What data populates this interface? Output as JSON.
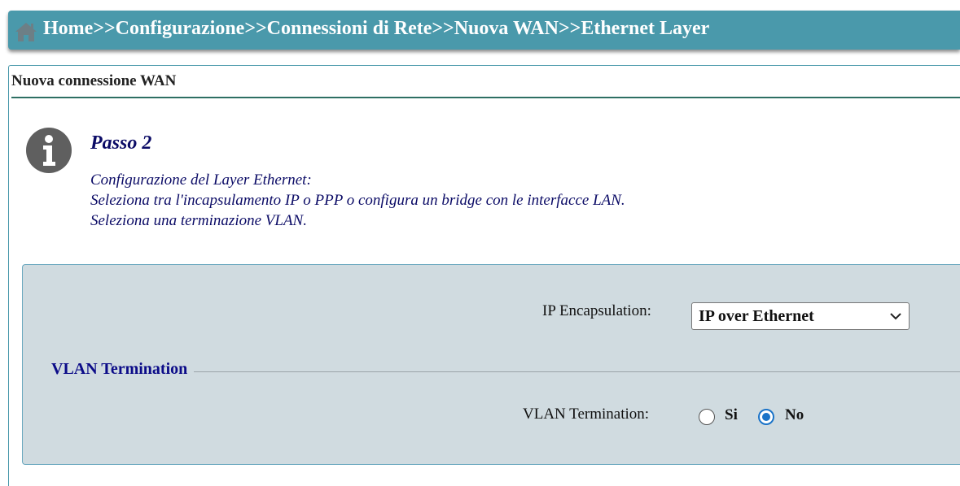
{
  "breadcrumb": {
    "text": "Home>>Configurazione>>Connessioni di Rete>>Nuova WAN>>Ethernet Layer",
    "icon": "home-icon"
  },
  "panel": {
    "title": "Nuova connessione WAN"
  },
  "step": {
    "icon": "info-icon",
    "title": "Passo 2",
    "lines": [
      "Configurazione del Layer Ethernet:",
      "Seleziona tra l'incapsulamento IP o PPP o configura un bridge con le interfacce LAN.",
      "Seleziona una terminazione VLAN."
    ]
  },
  "form": {
    "ip_encapsulation_label": "IP Encapsulation:",
    "ip_encapsulation_value": "IP over Ethernet",
    "vlan_section_title": "VLAN Termination",
    "vlan_termination_label": "VLAN Termination:",
    "vlan_options": [
      {
        "label": "Si",
        "selected": false
      },
      {
        "label": "No",
        "selected": true
      }
    ]
  },
  "colors": {
    "header_bg": "#4a99ab",
    "form_bg": "#d0dbe0",
    "text_blue": "#0b0b66",
    "radio_selected": "#1a73c8"
  }
}
